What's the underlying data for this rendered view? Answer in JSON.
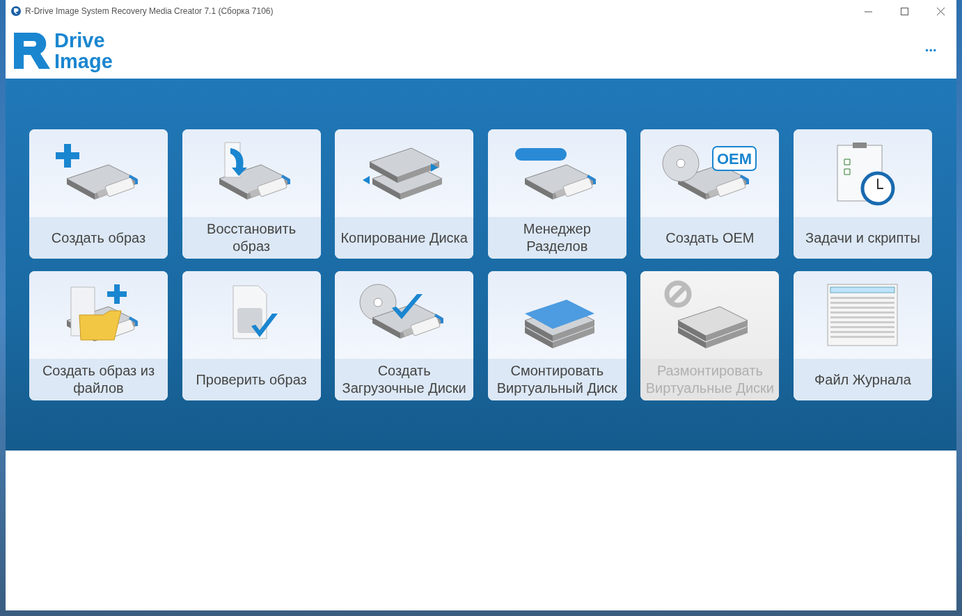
{
  "window": {
    "title": "R-Drive Image System Recovery Media Creator 7.1 (Сборка 7106)"
  },
  "logo": {
    "line_1": "Drive",
    "line_2": "Image"
  },
  "menu_button": {
    "label": "•••"
  },
  "tiles": [
    {
      "label": "Создать образ",
      "kind": "plus",
      "disabled": false
    },
    {
      "label": "Восстановить\nобраз",
      "kind": "restore",
      "disabled": false
    },
    {
      "label": "Копирование Диска",
      "kind": "copy",
      "disabled": false
    },
    {
      "label": "Менеджер\nРазделов",
      "kind": "partition",
      "disabled": false
    },
    {
      "label": "Создать OEM",
      "kind": "oem",
      "badge": "OEM",
      "disabled": false
    },
    {
      "label": "Задачи и скрипты",
      "kind": "tasks",
      "disabled": false
    },
    {
      "label": "Создать образ из файлов",
      "kind": "folder",
      "disabled": false
    },
    {
      "label": "Проверить образ",
      "kind": "verify",
      "disabled": false
    },
    {
      "label": "Создать Загрузочные Диски",
      "kind": "boot",
      "disabled": false
    },
    {
      "label": "Смонтировать Виртуальный Диск",
      "kind": "mount",
      "disabled": false
    },
    {
      "label": "Размонтировать Виртуальные Диски",
      "kind": "unmount",
      "disabled": true
    },
    {
      "label": "Файл Журнала",
      "kind": "log",
      "disabled": false
    }
  ]
}
